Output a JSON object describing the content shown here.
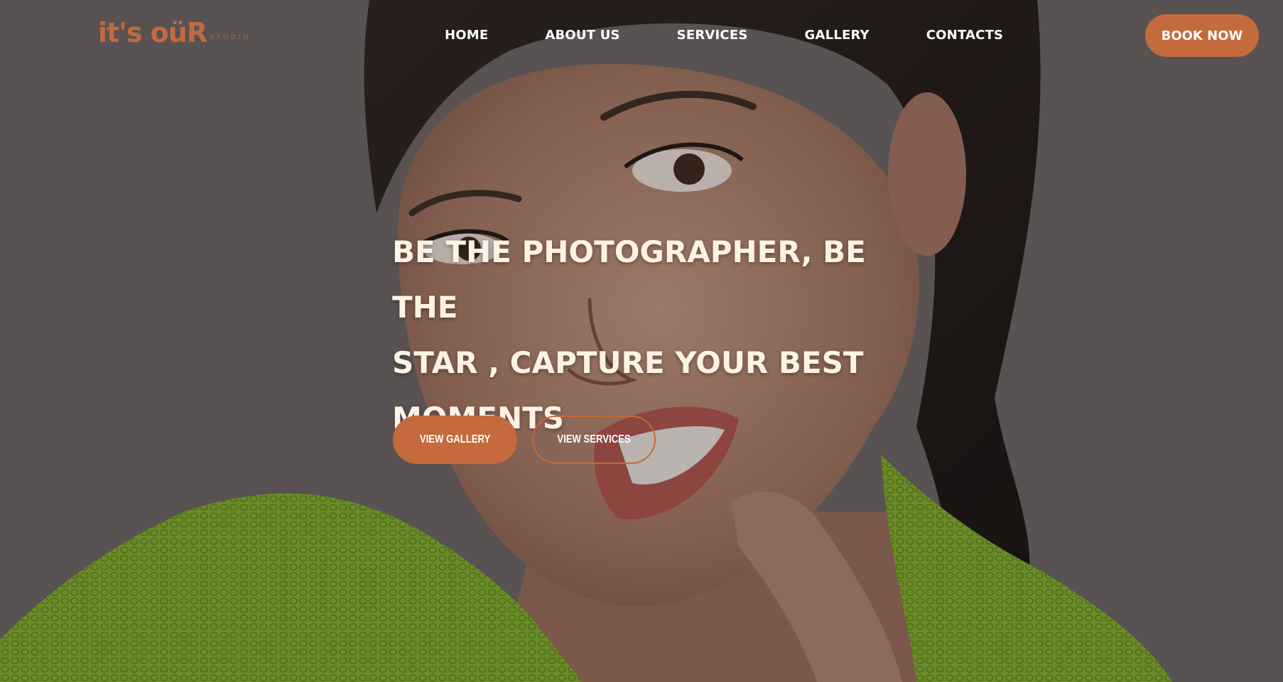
{
  "brand": {
    "logo_text": "it's oüR",
    "logo_sub": "STUDIO",
    "accent_color": "#c46a3c"
  },
  "nav": {
    "items": [
      {
        "label": "HOME"
      },
      {
        "label": "ABOUT US"
      },
      {
        "label": "SERVICES"
      },
      {
        "label": "GALLERY"
      },
      {
        "label": "CONTACTS"
      }
    ],
    "cta_label": "BOOK NOW"
  },
  "hero": {
    "headline_lines": [
      "BE THE PHOTOGRAPHER, BE THE",
      "STAR , CAPTURE YOUR BEST",
      "MOMENTS"
    ],
    "primary_button": "VIEW GALLERY",
    "secondary_button": "VIEW SERVICES"
  }
}
